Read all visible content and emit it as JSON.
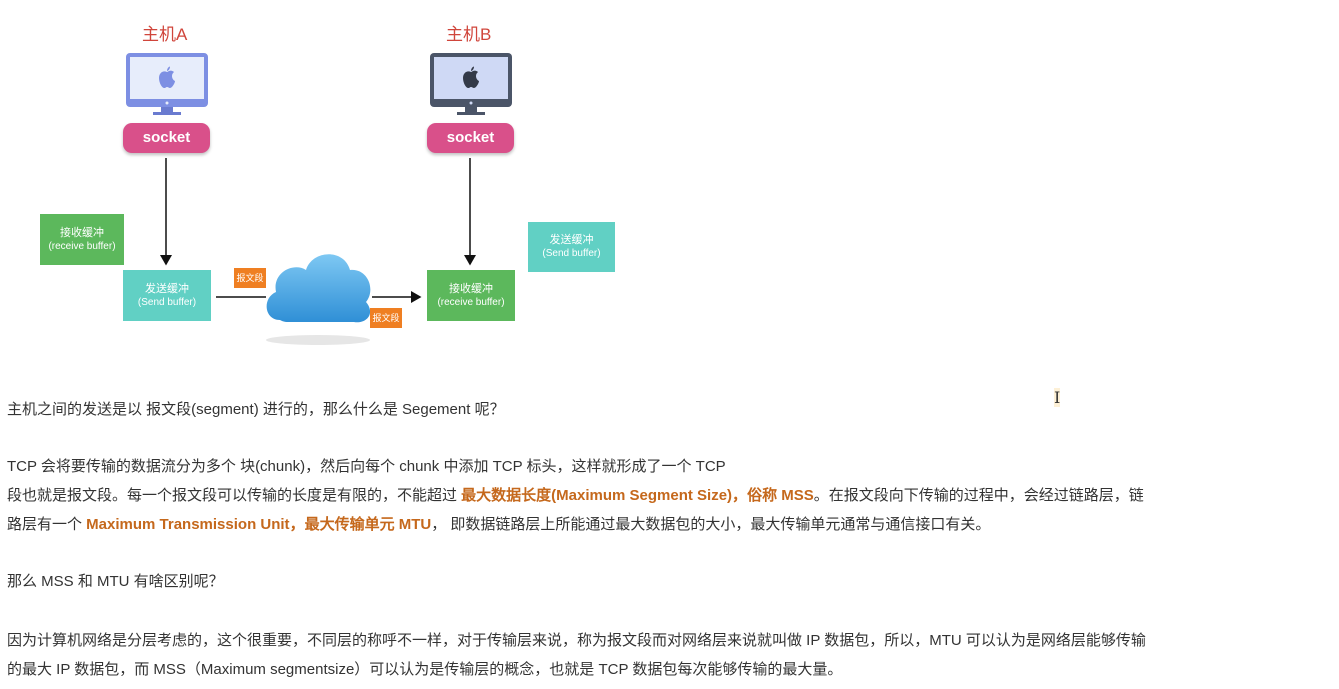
{
  "diagram": {
    "host_a": {
      "label": "主机A",
      "socket": "socket"
    },
    "host_b": {
      "label": "主机B",
      "socket": "socket"
    },
    "buffers": {
      "receive_left": {
        "cn": "接收缓冲",
        "en": "(receive buffer)"
      },
      "send_left": {
        "cn": "发送缓冲",
        "en": "(Send buffer)"
      },
      "receive_right": {
        "cn": "接收缓冲",
        "en": "(receive buffer)"
      },
      "send_right": {
        "cn": "发送缓冲",
        "en": "(Send buffer)"
      }
    },
    "segment_tags": [
      "报文段",
      "报文段"
    ],
    "colors": {
      "host_label": "#d0453b",
      "socket": "#d9508a",
      "green": "#5cb85c",
      "teal": "#61d0c4",
      "segment": "#ef7f22",
      "highlight": "#c5681c"
    },
    "icons": [
      "apple-logo-icon",
      "cloud-icon",
      "arrow-icon"
    ]
  },
  "text": {
    "p1": "主机之间的发送是以  报文段(segment) 进行的，那么什么是 Segement 呢？",
    "p2_line1": "TCP 会将要传输的数据流分为多个 块(chunk)，然后向每个 chunk 中添加 TCP 标头，这样就形成了一个 TCP",
    "p2_line2_a": "段也就是报文段。每一个报文段可以传输的长度是有限的，不能超过 ",
    "p2_line2_hl1": "最大数据长度(Maximum Segment Size)",
    "p2_line2_b": "，",
    "p2_line2_hl2": "俗称  MSS",
    "p2_line2_c": "。在报文段向下传输的过程中，会经过链路层，链",
    "p2_line3_a": "路层有一个  ",
    "p2_line3_hl1": "Maximum Transmission Unit",
    "p2_line3_b": "，",
    "p2_line3_hl2": "最大传输单元 MTU",
    "p2_line3_c": "，  即数据链路层上所能通过最大数据包的大小，最大传输单元通常与通信接口有关。",
    "p3": "那么 MSS 和 MTU 有啥区别呢？",
    "p4_line1": "因为计算机网络是分层考虑的，这个很重要，不同层的称呼不一样，对于传输层来说，称为报文段而对网络层来说就叫做 IP 数据包，所以，MTU 可以认为是网络层能够传输",
    "p4_line2": "的最大 IP 数据包，而 MSS（Maximum segmentsize）可以认为是传输层的概念，也就是 TCP 数据包每次能够传输的最大量。",
    "cursor": "I"
  }
}
